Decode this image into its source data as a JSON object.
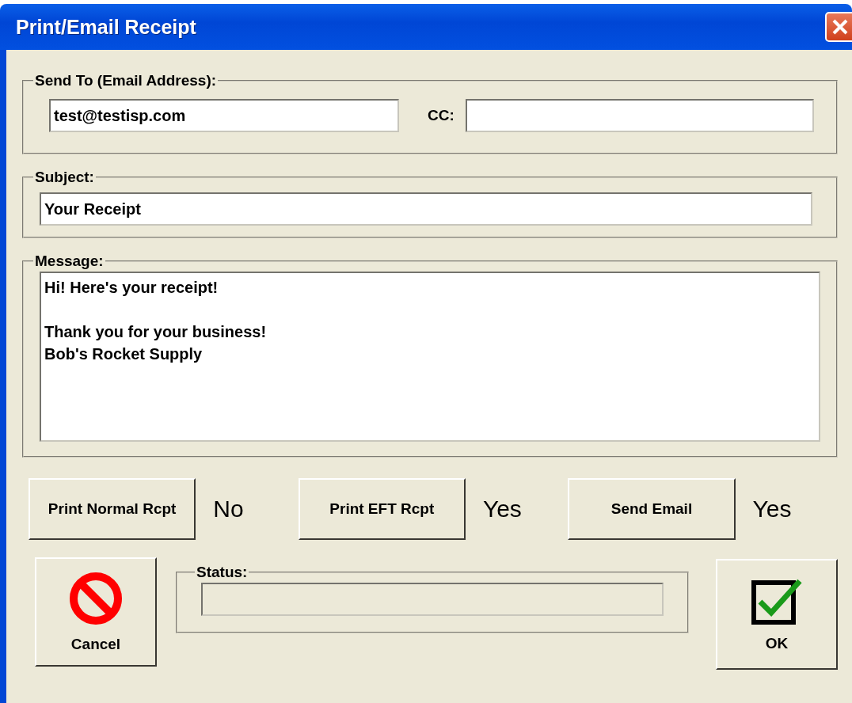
{
  "window": {
    "title": "Print/Email Receipt"
  },
  "send_to": {
    "legend": "Send To (Email Address):",
    "email": {
      "value": "test@testisp.com"
    },
    "cc": {
      "label": "CC:"
    }
  },
  "subject": {
    "legend": "Subject:",
    "value": "Your Receipt"
  },
  "message": {
    "legend": "Message:",
    "value": "Hi! Here's your receipt!\n\nThank you for your business!\nBob's Rocket Supply"
  },
  "actions": [
    {
      "label": "Print Normal Rcpt",
      "result": "No"
    },
    {
      "label": "Print EFT Rcpt",
      "result": "Yes"
    },
    {
      "label": "Send Email",
      "result": "Yes"
    }
  ],
  "cancel_button": {
    "label": "Cancel"
  },
  "status": {
    "legend": "Status:"
  },
  "ok_button": {
    "label": "OK"
  }
}
